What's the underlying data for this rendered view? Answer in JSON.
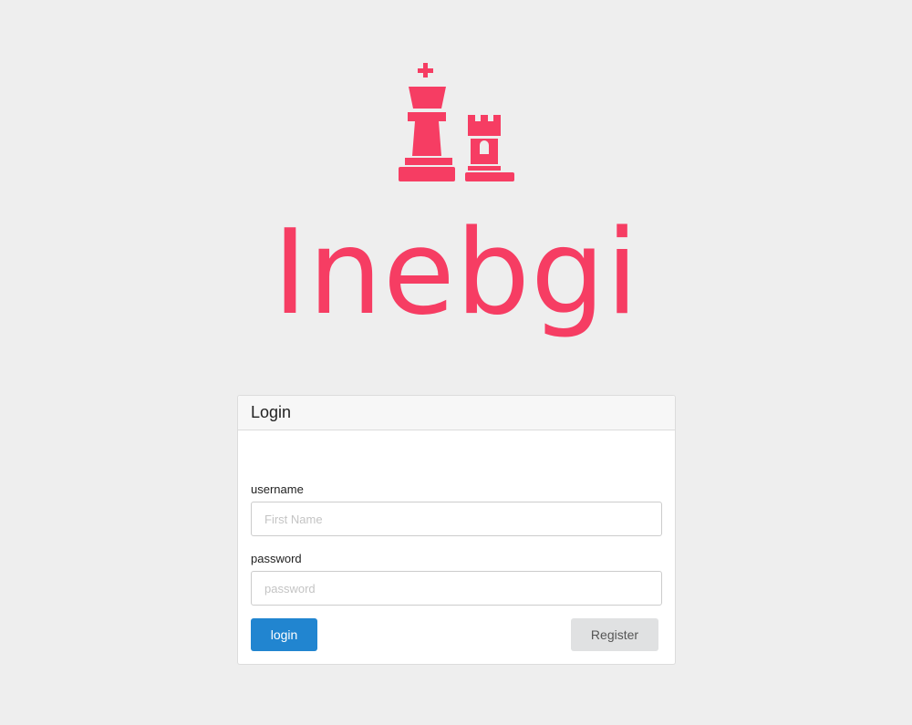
{
  "brand": {
    "name": "Inebgi",
    "logo_icon": "chess-king-rook-icon",
    "accent_color": "#f63d63"
  },
  "login_card": {
    "title": "Login",
    "username": {
      "label": "username",
      "placeholder": "First Name",
      "value": ""
    },
    "password": {
      "label": "password",
      "placeholder": "password",
      "value": ""
    },
    "login_label": "login",
    "register_label": "Register",
    "login_color": "#2185d0",
    "register_color": "#e0e1e2"
  }
}
